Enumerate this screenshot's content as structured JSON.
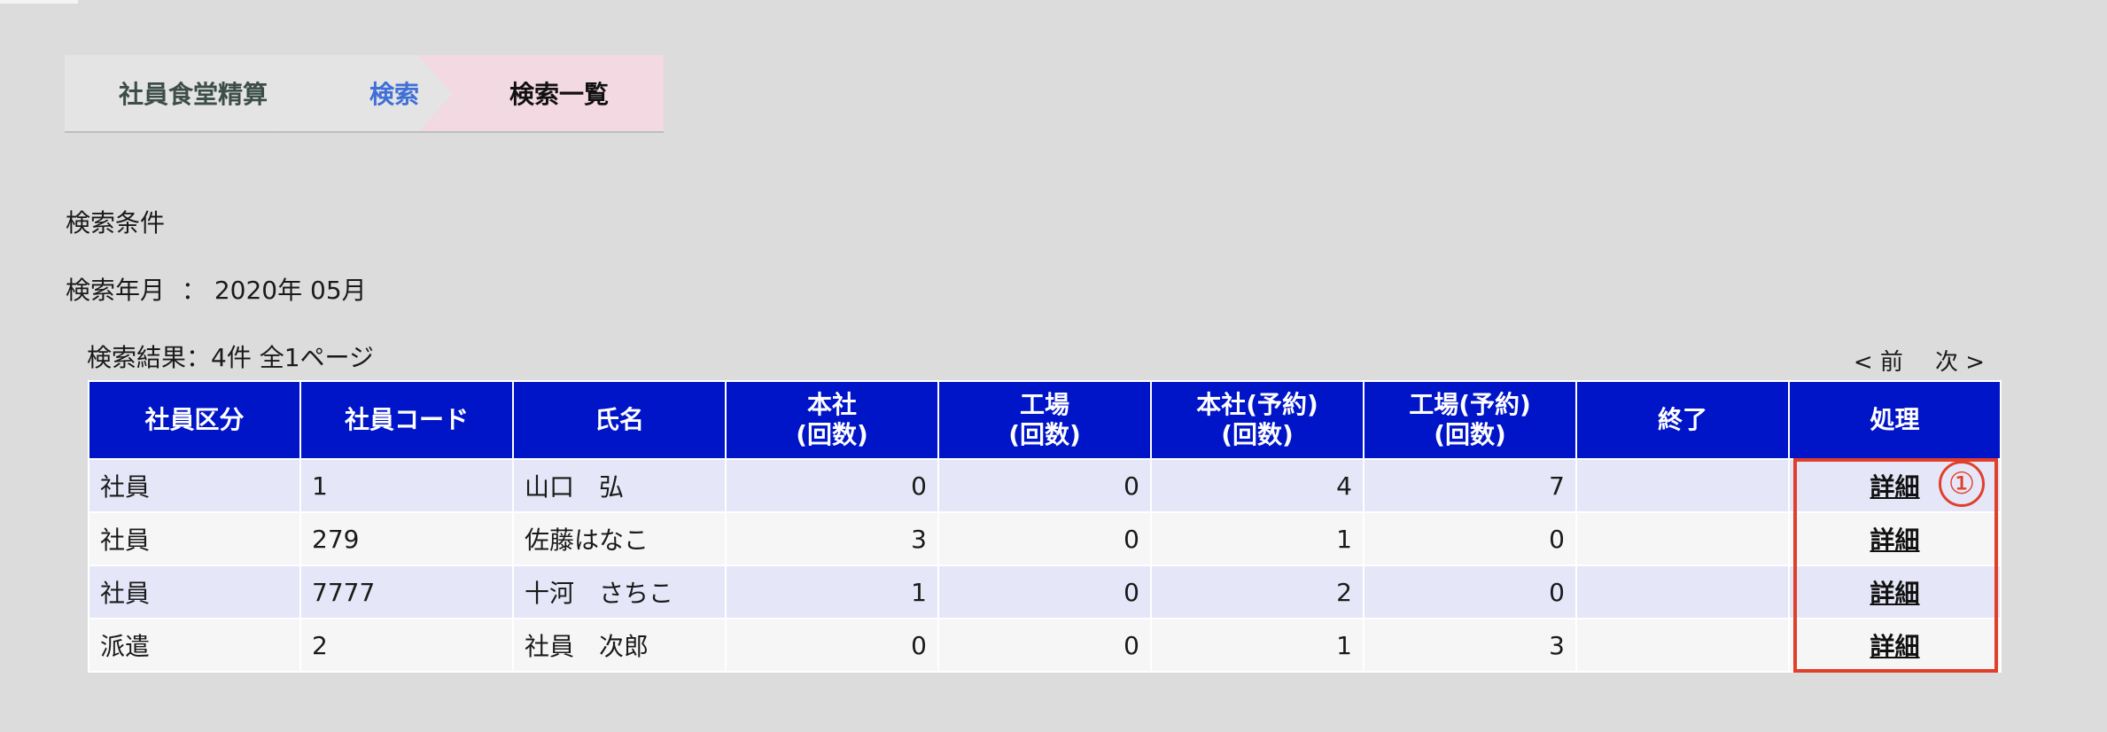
{
  "breadcrumb": {
    "items": [
      {
        "label": "社員食堂精算"
      },
      {
        "label": "検索"
      },
      {
        "label": "検索一覧"
      }
    ]
  },
  "conditions": {
    "title": "検索条件",
    "label": "検索年月",
    "separator": "：",
    "value": "2020年 05月"
  },
  "results": {
    "summary": "検索結果：4件 全1ページ",
    "pager": {
      "prev": "< 前",
      "next": "次 >"
    }
  },
  "table": {
    "headers": [
      "社員区分",
      "社員コード",
      "氏名",
      "本社\n(回数)",
      "工場\n(回数)",
      "本社(予約)\n(回数)",
      "工場(予約)\n(回数)",
      "終了",
      "処理"
    ],
    "rows": [
      [
        "社員",
        "1",
        "山口　弘",
        "0",
        "0",
        "4",
        "7",
        "",
        "詳細"
      ],
      [
        "社員",
        "279",
        "佐藤はなこ",
        "3",
        "0",
        "1",
        "0",
        "",
        "詳細"
      ],
      [
        "社員",
        "7777",
        "十河　さちこ",
        "1",
        "0",
        "2",
        "0",
        "",
        "詳細"
      ],
      [
        "派遣",
        "2",
        "社員　次郎",
        "0",
        "0",
        "1",
        "3",
        "",
        "詳細"
      ]
    ]
  },
  "annotation": {
    "marker": "①",
    "color": "#e0402a"
  },
  "colors": {
    "header_bg": "#0014c8",
    "page_bg": "#dcdcdc",
    "row_odd": "#e5e6f7",
    "row_even": "#f6f6f6"
  }
}
